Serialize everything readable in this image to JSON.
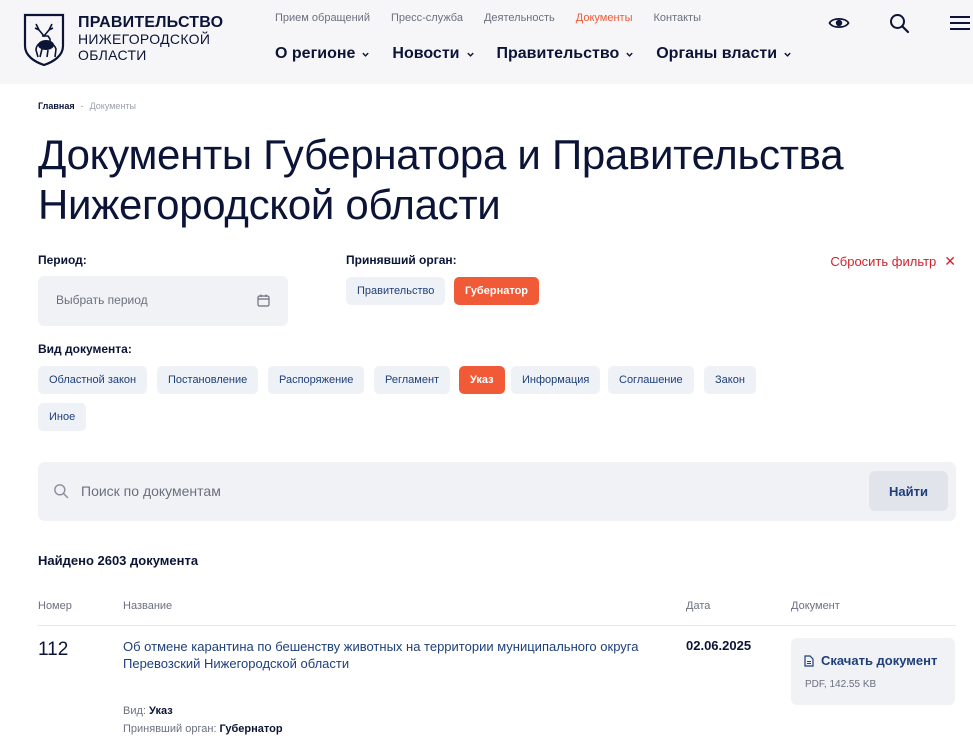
{
  "header": {
    "logo_line1": "ПРАВИТЕЛЬСТВО",
    "logo_line2": "НИЖЕГОРОДСКОЙ",
    "logo_line3": "ОБЛАСТИ",
    "top_links": [
      "Прием обращений",
      "Пресс-служба",
      "Деятельность",
      "Документы",
      "Контакты"
    ],
    "active_top_link": "Документы",
    "main_nav": [
      "О регионе",
      "Новости",
      "Правительство",
      "Органы власти"
    ],
    "icons": [
      "eye-icon",
      "search-icon",
      "menu-icon"
    ]
  },
  "breadcrumb": {
    "home": "Главная",
    "separator": "-",
    "current": "Документы"
  },
  "title": "Документы Губернатора и Правительства Нижегородской области",
  "filters": {
    "period_label": "Период:",
    "period_placeholder": "Выбрать период",
    "organ_label": "Принявший орган:",
    "organs": [
      "Правительство",
      "Губернатор"
    ],
    "active_organ": "Губернатор",
    "reset_label": "Сбросить фильтр",
    "type_label": "Вид документа:",
    "types": [
      "Областной закон",
      "Постановление",
      "Распоряжение",
      "Регламент",
      "Указ",
      "Информация",
      "Соглашение",
      "Закон",
      "Иное"
    ],
    "active_type": "Указ"
  },
  "search": {
    "placeholder": "Поиск по документам",
    "value": "",
    "button": "Найти"
  },
  "results": {
    "found": "Найдено 2603 документа",
    "columns": [
      "Номер",
      "Название",
      "Дата",
      "Документ"
    ],
    "rows": [
      {
        "number": "112",
        "name": "Об отмене карантина по бешенству животных на территории муниципального округа Перевозский Нижегородской области",
        "date": "02.06.2025",
        "download_label": "Скачать документ",
        "file_meta": "PDF, 142.55 KB",
        "type_key": "Вид:",
        "type_value": "Указ",
        "organ_key": "Принявший орган:",
        "organ_value": "Губернатор"
      }
    ]
  },
  "colors": {
    "accent": "#f05a37",
    "link": "#1e3f7a",
    "reset": "#d3202c",
    "text": "#0b1437"
  }
}
